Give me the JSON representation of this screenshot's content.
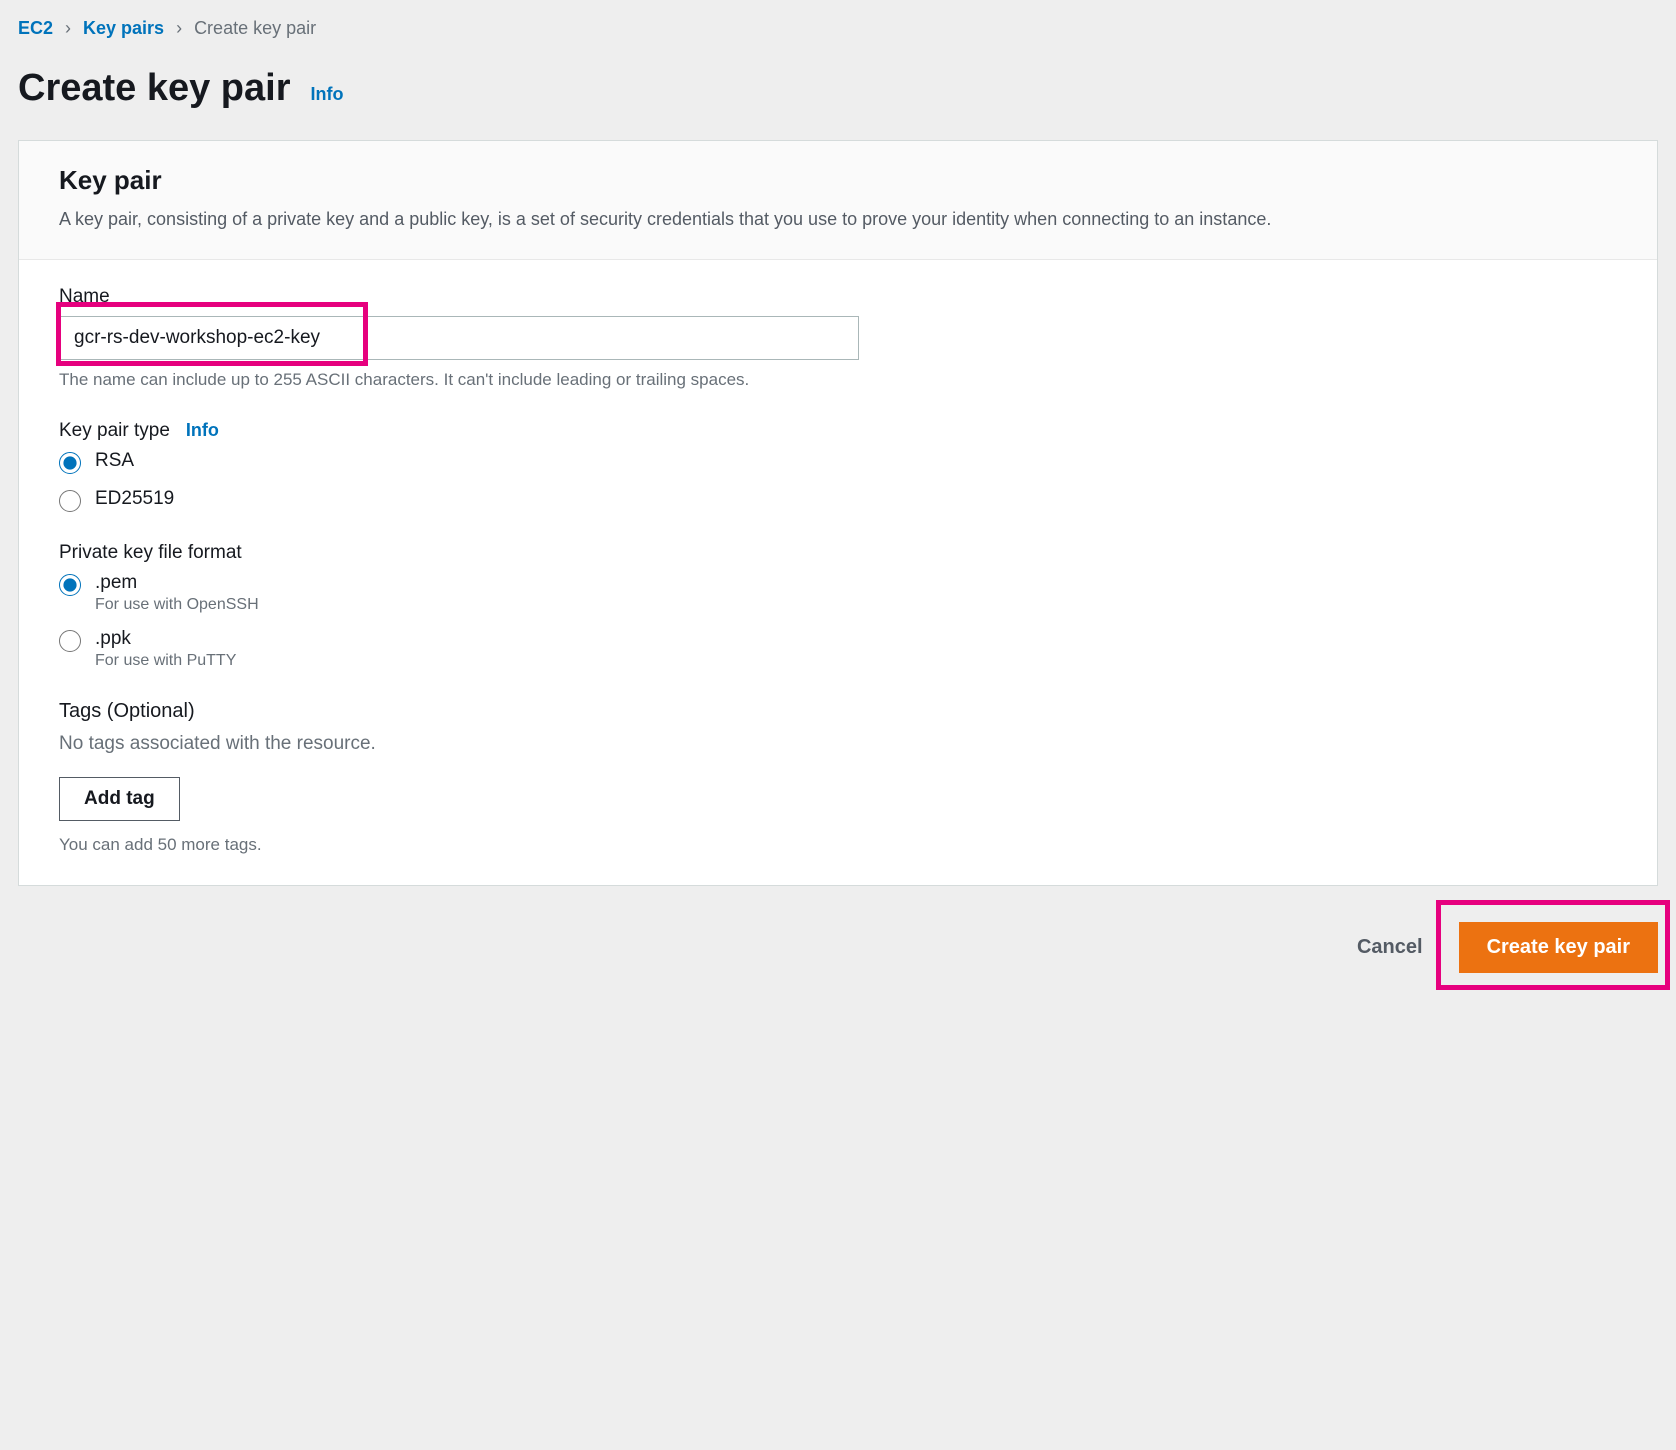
{
  "breadcrumb": {
    "root": "EC2",
    "mid": "Key pairs",
    "current": "Create key pair"
  },
  "title": "Create key pair",
  "info_label": "Info",
  "panel": {
    "heading": "Key pair",
    "description": "A key pair, consisting of a private key and a public key, is a set of security credentials that you use to prove your identity when connecting to an instance."
  },
  "name_field": {
    "label": "Name",
    "value": "gcr-rs-dev-workshop-ec2-key",
    "help": "The name can include up to 255 ASCII characters. It can't include leading or trailing spaces."
  },
  "keypair_type": {
    "label": "Key pair type",
    "info": "Info",
    "options": {
      "rsa": "RSA",
      "ed25519": "ED25519"
    }
  },
  "file_format": {
    "label": "Private key file format",
    "pem": {
      "label": ".pem",
      "sub": "For use with OpenSSH"
    },
    "ppk": {
      "label": ".ppk",
      "sub": "For use with PuTTY"
    }
  },
  "tags": {
    "heading": "Tags (Optional)",
    "empty": "No tags associated with the resource.",
    "add_button": "Add tag",
    "help": "You can add 50 more tags."
  },
  "actions": {
    "cancel": "Cancel",
    "create": "Create key pair"
  }
}
